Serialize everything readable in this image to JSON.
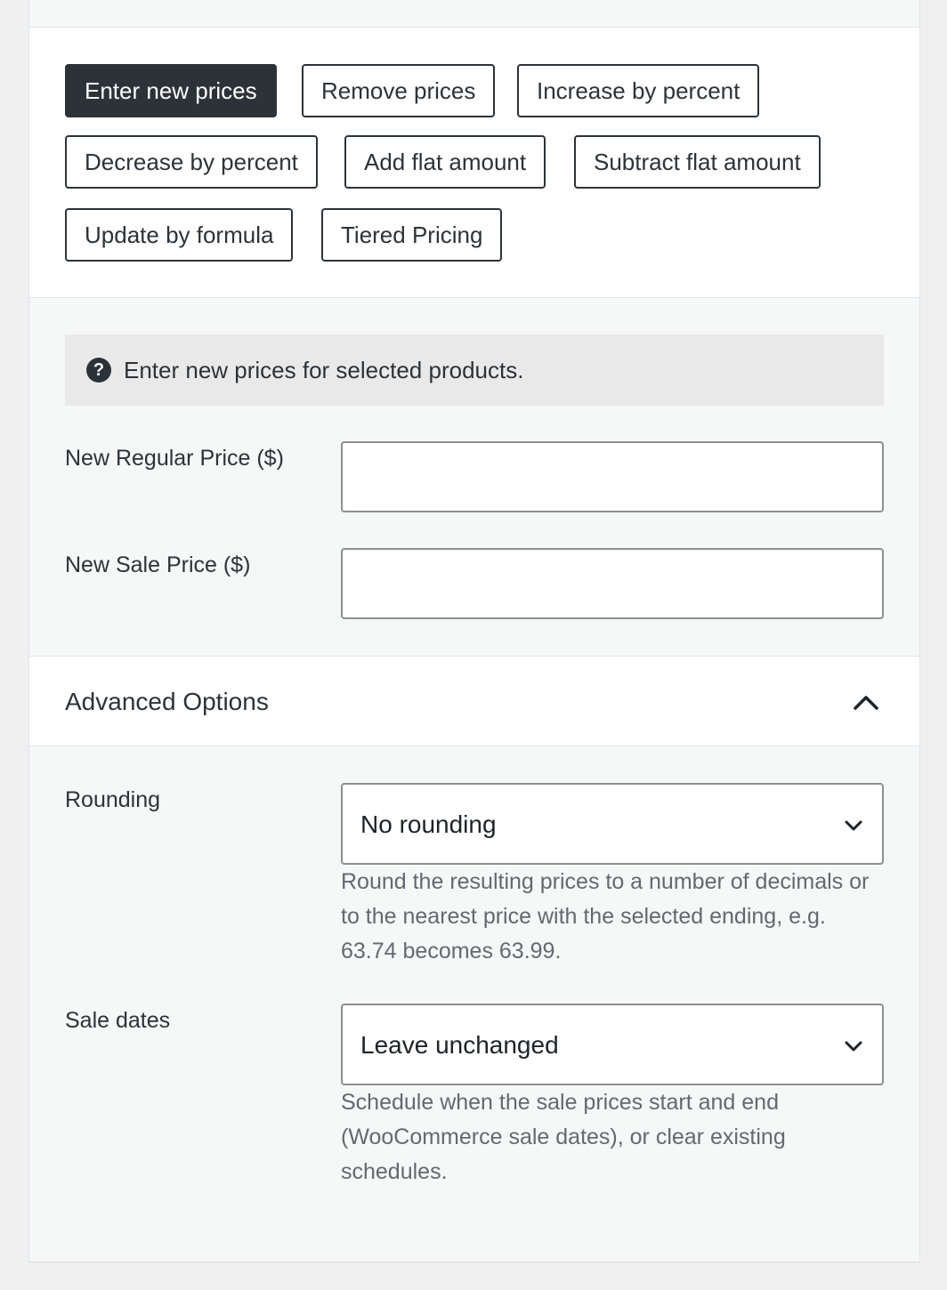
{
  "operations": {
    "buttons": [
      {
        "label": "Enter new prices",
        "active": true
      },
      {
        "label": "Remove prices",
        "active": false
      },
      {
        "label": "Increase by percent",
        "active": false
      },
      {
        "label": "Decrease by percent",
        "active": false
      },
      {
        "label": "Add flat amount",
        "active": false
      },
      {
        "label": "Subtract flat amount",
        "active": false
      },
      {
        "label": "Update by formula",
        "active": false
      },
      {
        "label": "Tiered Pricing",
        "active": false
      }
    ]
  },
  "notice": {
    "icon": "question-circle-icon",
    "text": "Enter new prices for selected products."
  },
  "fields": {
    "regular_price": {
      "label": "New Regular Price ($)",
      "value": ""
    },
    "sale_price": {
      "label": "New Sale Price ($)",
      "value": ""
    }
  },
  "advanced": {
    "title": "Advanced Options",
    "expanded": true,
    "icon": "chevron-up-icon",
    "rounding": {
      "label": "Rounding",
      "selected": "No rounding",
      "help": "Round the resulting prices to a number of decimals or to the nearest price with the selected ending, e.g. 63.74 becomes 63.99."
    },
    "sale_dates": {
      "label": "Sale dates",
      "selected": "Leave unchanged",
      "help": "Schedule when the sale prices start and end (WooCommerce sale dates), or clear existing schedules."
    }
  },
  "colors": {
    "active_button_bg": "#2c3338",
    "panel_bg": "#f6f7f7",
    "notice_bg": "#e9e9ea"
  }
}
